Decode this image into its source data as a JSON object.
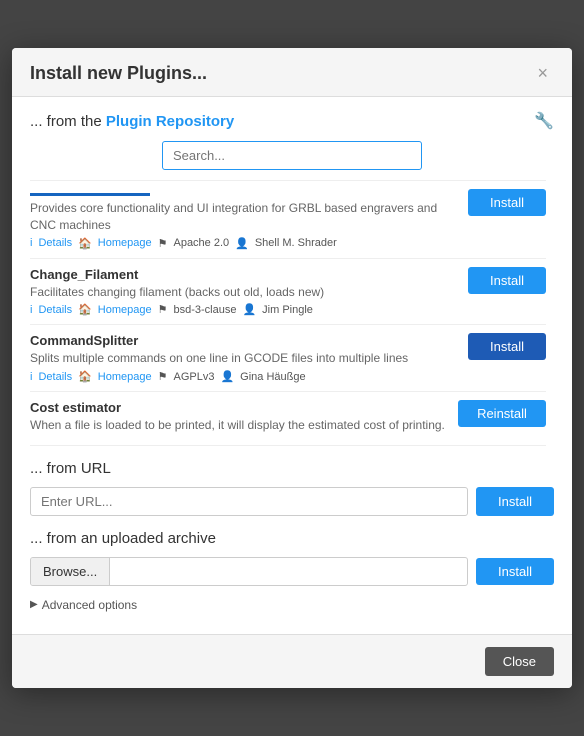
{
  "modal": {
    "title": "Install new Plugins...",
    "close_label": "×"
  },
  "plugin_repo": {
    "section_label": "... from the ",
    "section_link": "Plugin Repository",
    "search_placeholder": "Search...",
    "wrench": "🔧"
  },
  "plugins": [
    {
      "name": "",
      "desc": "Provides core functionality and UI integration for GRBL based engravers and CNC machines",
      "meta_details": "Details",
      "meta_homepage": "Homepage",
      "meta_license": "Apache 2.0",
      "meta_author": "Shell M. Shrader",
      "button": "Install",
      "button_type": "install"
    },
    {
      "name": "Change_Filament",
      "desc": "Facilitates changing filament (backs out old, loads new)",
      "meta_details": "Details",
      "meta_homepage": "Homepage",
      "meta_license": "bsd-3-clause",
      "meta_author": "Jim Pingle",
      "button": "Install",
      "button_type": "install"
    },
    {
      "name": "CommandSplitter",
      "desc": "Splits multiple commands on one line in GCODE files into multiple lines",
      "meta_details": "Details",
      "meta_homepage": "Homepage",
      "meta_license": "AGPLv3",
      "meta_author": "Gina Häußge",
      "button": "Install",
      "button_type": "install"
    },
    {
      "name": "Cost estimator",
      "desc": "When a file is loaded to be printed, it will display the estimated cost of printing.",
      "meta_details": "",
      "meta_homepage": "",
      "meta_license": "",
      "meta_author": "",
      "button": "Reinstall",
      "button_type": "reinstall"
    }
  ],
  "url_section": {
    "label": "... from URL",
    "placeholder": "Enter URL...",
    "button": "Install"
  },
  "archive_section": {
    "label": "... from an uploaded archive",
    "browse_label": "Browse...",
    "button": "Install"
  },
  "advanced": {
    "label": "Advanced options"
  },
  "footer": {
    "close_label": "Close"
  }
}
